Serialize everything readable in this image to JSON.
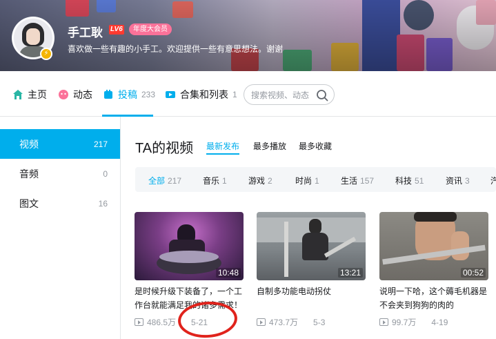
{
  "profile": {
    "name": "手工耿",
    "level": "LV6",
    "vip_label": "年度大会员",
    "signature": "喜欢做一些有趣的小手工。欢迎提供一些有意思想法。谢谢"
  },
  "nav": {
    "items": [
      {
        "label": "主页",
        "icon": "home-icon",
        "color": "#29b6a5"
      },
      {
        "label": "动态",
        "icon": "dynamic-icon",
        "color": "#fb7299"
      },
      {
        "label": "投稿",
        "count": "233",
        "icon": "upload-icon",
        "color": "#00aeec"
      },
      {
        "label": "合集和列表",
        "count": "1",
        "icon": "playlist-icon",
        "color": "#00aeec"
      }
    ],
    "search_placeholder": "搜索视频、动态"
  },
  "sidebar": {
    "items": [
      {
        "label": "视频",
        "count": "217"
      },
      {
        "label": "音频",
        "count": "0"
      },
      {
        "label": "图文",
        "count": "16"
      }
    ]
  },
  "main": {
    "title": "TA的视频",
    "sort_tabs": [
      "最新发布",
      "最多播放",
      "最多收藏"
    ],
    "filters": [
      {
        "label": "全部",
        "count": "217"
      },
      {
        "label": "音乐",
        "count": "1"
      },
      {
        "label": "游戏",
        "count": "2"
      },
      {
        "label": "时尚",
        "count": "1"
      },
      {
        "label": "生活",
        "count": "157"
      },
      {
        "label": "科技",
        "count": "51"
      },
      {
        "label": "资讯",
        "count": "3"
      },
      {
        "label": "汽"
      }
    ],
    "videos": [
      {
        "duration": "10:48",
        "title": "是时候升级下装备了，一个工作台就能满足我的诸多需求！",
        "plays": "486.5万",
        "date": "5-21"
      },
      {
        "duration": "13:21",
        "title": "自制多功能电动拐仗",
        "plays": "473.7万",
        "date": "5-3"
      },
      {
        "duration": "00:52",
        "title": "说明一下哈，这个薅毛机器是不会夹到狗狗的肉的",
        "plays": "99.7万",
        "date": "4-19"
      }
    ]
  },
  "colors": {
    "accent": "#00aeec",
    "annotation": "#e0231c",
    "vip": "#fb7299"
  }
}
